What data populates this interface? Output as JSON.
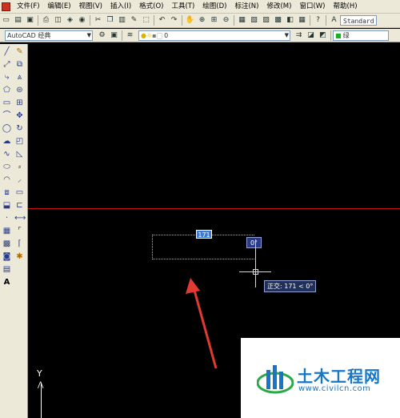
{
  "menubar": {
    "items": [
      "文件(F)",
      "编辑(E)",
      "视图(V)",
      "插入(I)",
      "格式(O)",
      "工具(T)",
      "绘图(D)",
      "标注(N)",
      "修改(M)",
      "窗口(W)",
      "帮助(H)"
    ]
  },
  "toolbar1": {
    "text_style": "Standard"
  },
  "toolbar2": {
    "workspace": "AutoCAD 经典",
    "layer_value": "0",
    "color_value": "绿"
  },
  "left_toolbar": {
    "text_tool_glyph": "A"
  },
  "canvas": {
    "dynamic_input_value": "171",
    "angle_value": "0°",
    "polar_tooltip": "正交: 171 < 0°",
    "ucs_axis_label": "Y"
  },
  "watermark": {
    "title": "土木工程网",
    "url": "www.civilcn.com"
  },
  "colors": {
    "menu_bg": "#ece9d8",
    "crosshair_line": "#c41212",
    "annotation_arrow": "#e03a33",
    "watermark_blue": "#1677c9"
  }
}
